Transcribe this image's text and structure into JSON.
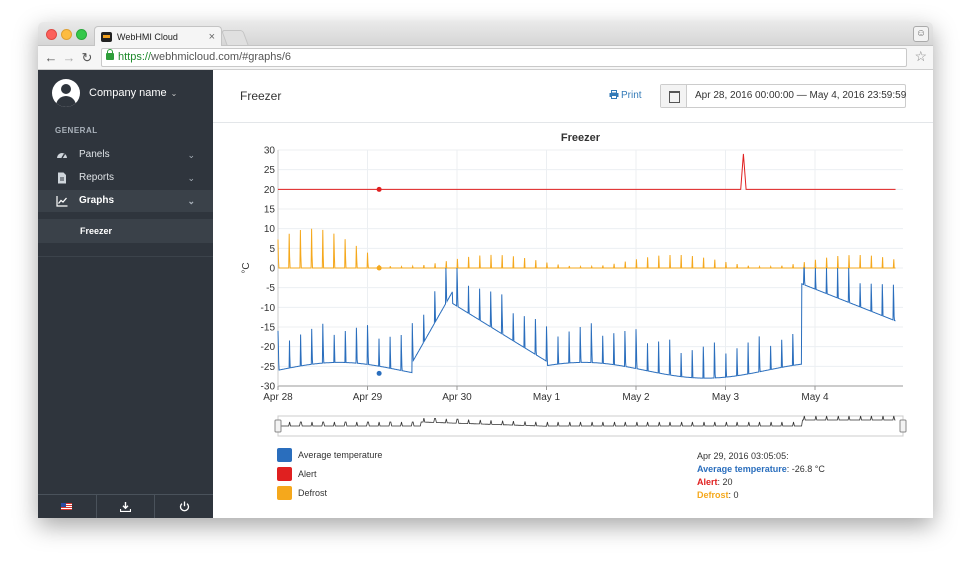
{
  "browser": {
    "tab_title": "WebHMI Cloud",
    "url_scheme": "https://",
    "url_rest": "webhmicloud.com/#graphs/6"
  },
  "sidebar": {
    "company": "Company name",
    "section": "GENERAL",
    "items": [
      {
        "label": "Panels",
        "icon": "dashboard-icon"
      },
      {
        "label": "Reports",
        "icon": "file-icon"
      },
      {
        "label": "Graphs",
        "icon": "line-chart-icon"
      }
    ],
    "subitem": "Freezer"
  },
  "header": {
    "title": "Freezer",
    "print": "Print",
    "date_range": "Apr 28, 2016 00:00:00 — May 4, 2016 23:59:59"
  },
  "chart_data": {
    "type": "line",
    "title": "Freezer",
    "ylabel": "°C",
    "ylim": [
      -30,
      30
    ],
    "yticks": [
      30,
      25,
      20,
      15,
      10,
      5,
      0,
      -5,
      -10,
      -15,
      -20,
      -25,
      -30
    ],
    "xticks": [
      "Apr 28",
      "Apr 29",
      "Apr 30",
      "May 1",
      "May 2",
      "May 3",
      "May 4"
    ],
    "xrange_days": [
      0,
      6.9
    ],
    "series": [
      {
        "name": "Average temperature",
        "color": "#2a6ebd",
        "baseline": -26,
        "peak": -16,
        "note": "periodic defrost spikes; warm period Apr 29 12:00 to Apr 30 00:00 and May 3 20:00 onward"
      },
      {
        "name": "Alert",
        "color": "#e02020",
        "values_const": 20,
        "spike": {
          "x": 5.2,
          "y": 29
        }
      },
      {
        "name": "Defrost",
        "color": "#f5a81c",
        "baseline": 0,
        "peak": 10
      }
    ],
    "legend": "bottom-left",
    "grid": true
  },
  "legend": [
    {
      "name": "Average temperature",
      "color": "#2a6ebd"
    },
    {
      "name": "Alert",
      "color": "#e02020"
    },
    {
      "name": "Defrost",
      "color": "#f5a81c"
    }
  ],
  "tooltip": {
    "time": "Apr 29, 2016 03:05:05:",
    "avg_label": "Average temperature",
    "avg_value": ": -26.8 °C",
    "alert_label": "Alert",
    "alert_value": ": 20",
    "defrost_label": "Defrost",
    "defrost_value": ": 0"
  }
}
